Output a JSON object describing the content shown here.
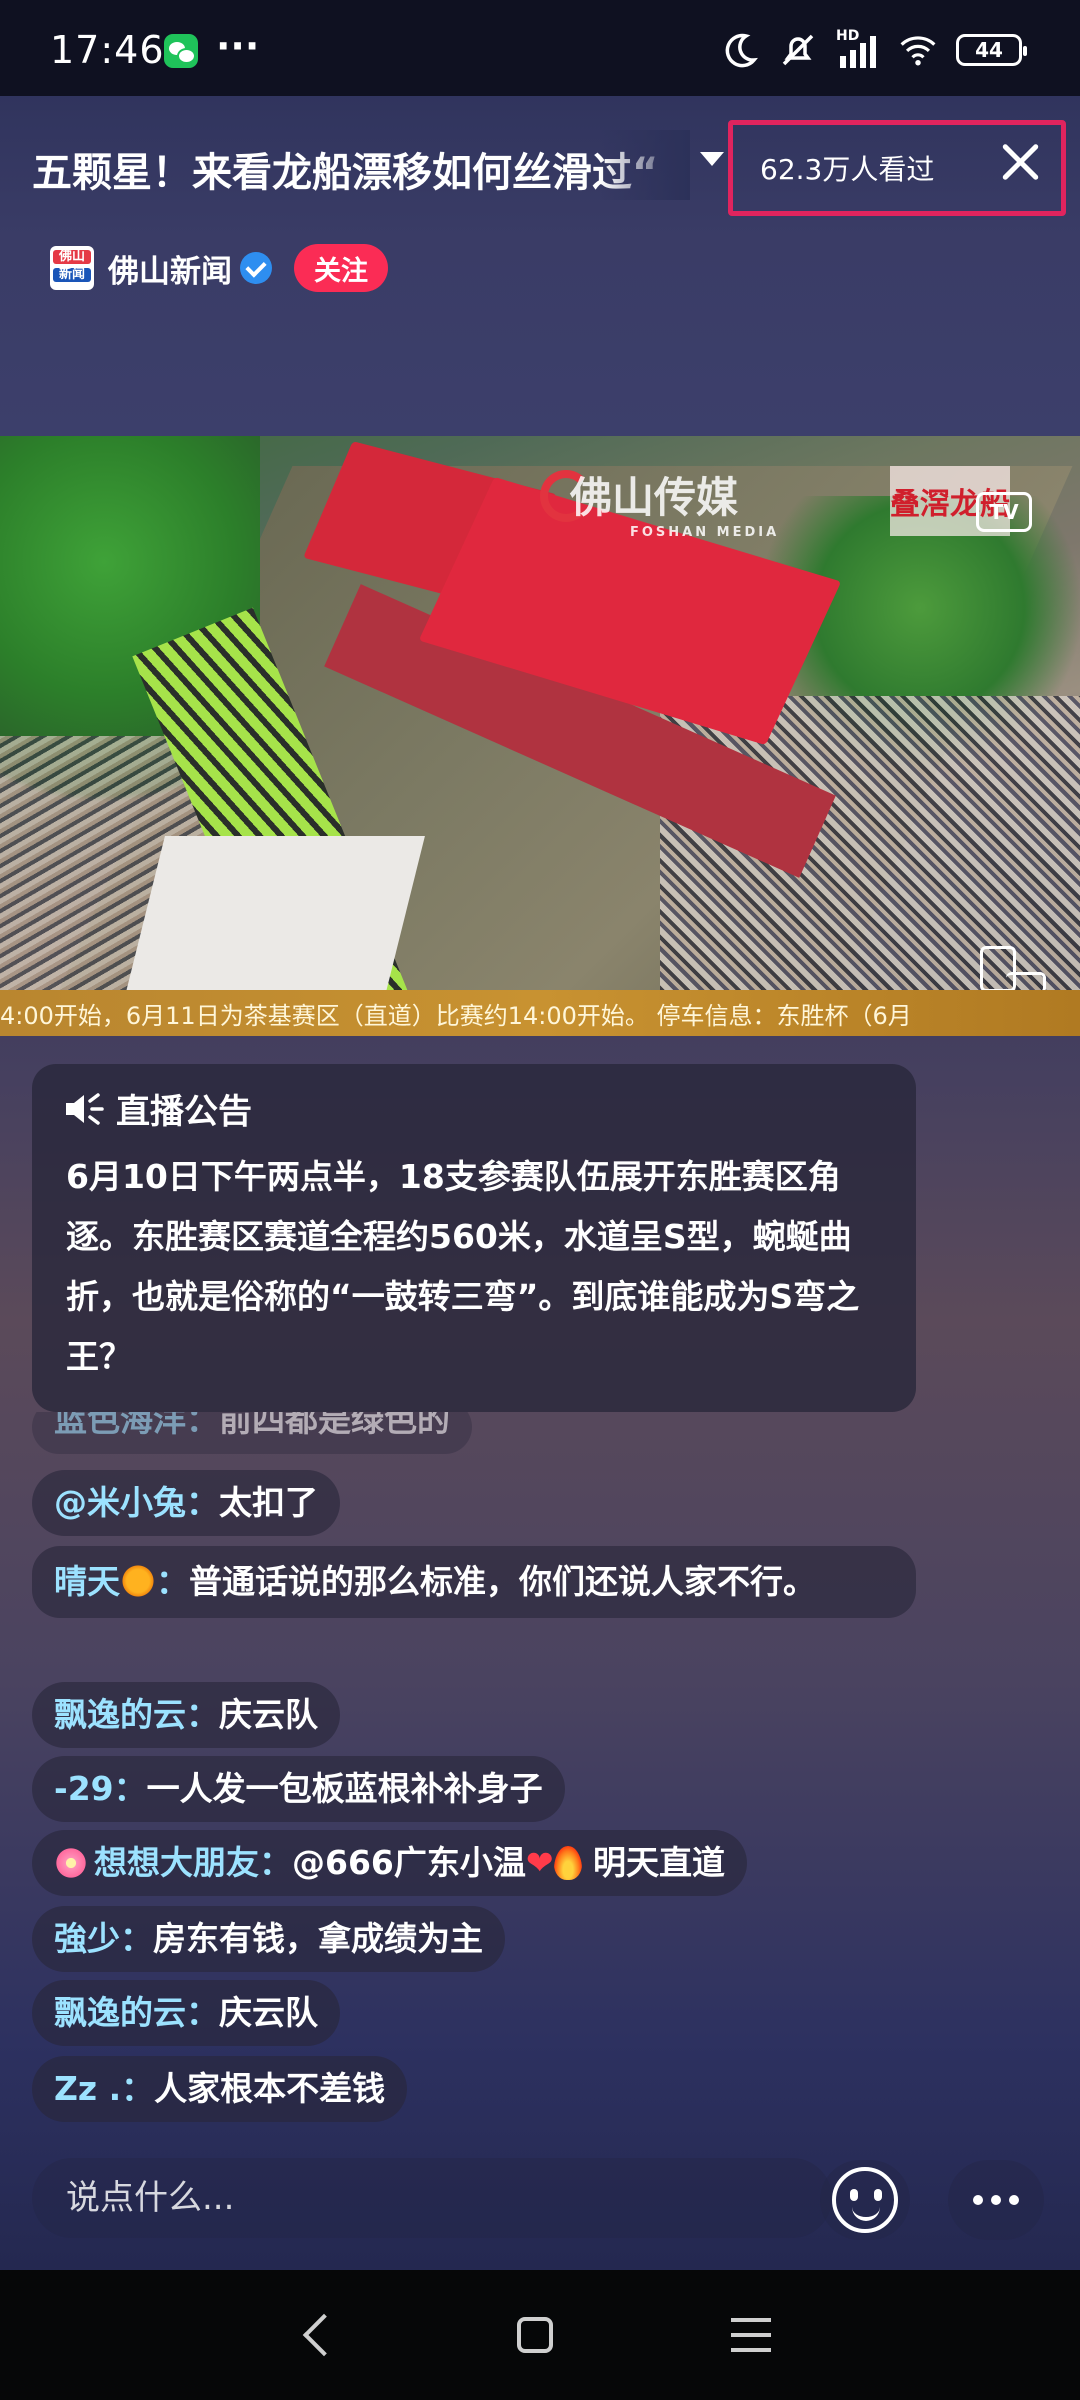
{
  "status_bar": {
    "time": "17:46",
    "more": "···",
    "hd_label": "HD",
    "battery": "44",
    "icons": [
      "wechat-icon",
      "moon-icon",
      "mute-icon",
      "signal-icon",
      "wifi-icon",
      "battery-icon"
    ]
  },
  "header": {
    "title": "五颗星！来看龙船漂移如何丝滑过“",
    "viewers": "62.3万人看过",
    "channel_logo_top": "佛山",
    "channel_logo_bottom": "新闻",
    "channel_name": "佛山新闻",
    "follow_label": "关注"
  },
  "video": {
    "watermark": "佛山传媒",
    "watermark_en": "FOSHAN MEDIA",
    "corner_badge": "叠滘龙船",
    "tv_label": "TV",
    "ticker": "4:00开始，6月11日为茶基赛区（直道）比赛约14:00开始。      停车信息：东胜杯（6月"
  },
  "announcement": {
    "heading": "直播公告",
    "body": "6月10日下午两点半，18支参赛队伍展开东胜赛区角逐。东胜赛区赛道全程约560米，水道呈S型，蜿蜒曲折，也就是俗称的“一鼓转三弯”。到底谁能成为S弯之王？"
  },
  "comments": [
    {
      "nick": "蓝色海洋：",
      "text": "前四都是绿色的"
    },
    {
      "nick": "@米小兔：",
      "text": "太扣了"
    },
    {
      "nick": "晴天",
      "nick_suffix": "：",
      "text": "普通话说的那么标准，你们还说人家不行。"
    },
    {
      "nick": "飘逸的云：",
      "text": "庆云队"
    },
    {
      "nick": "-29：",
      "text": "一人发一包板蓝根补补身子"
    },
    {
      "nick": "想想大朋友：",
      "text": "@666广东小温",
      "text2": " 明天直道"
    },
    {
      "nick": "強少：",
      "text": "房东有钱，拿成绩为主"
    },
    {
      "nick": "飘逸的云：",
      "text": "庆云队"
    },
    {
      "nick": "Zz .：",
      "text": "人家根本不差钱"
    }
  ],
  "input": {
    "placeholder": "说点什么..."
  },
  "colors": {
    "accent_follow": "#fb2c55",
    "nick_color": "#9ce2ff",
    "highlight_box": "#e0245e"
  }
}
